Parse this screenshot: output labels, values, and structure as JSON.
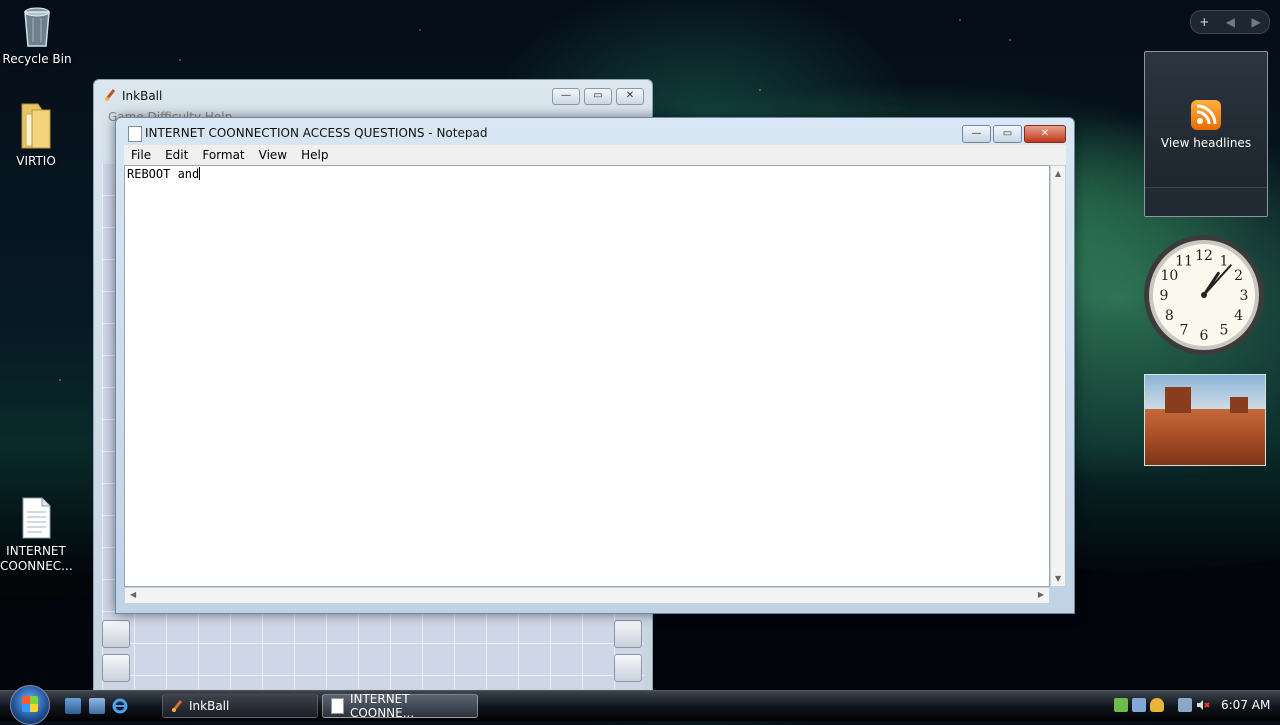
{
  "desktop": {
    "icons": [
      {
        "label": "Recycle Bin"
      },
      {
        "label": "VIRTIO"
      },
      {
        "label": "INTERNET COONNEC..."
      }
    ]
  },
  "sidebar": {
    "controls": {
      "add": "+",
      "prev": "◀",
      "next": "▶"
    },
    "feed": {
      "label": "View headlines",
      "icon": "rss-icon"
    },
    "clock": {
      "numerals": [
        "12",
        "1",
        "2",
        "3",
        "4",
        "5",
        "6",
        "7",
        "8",
        "9",
        "10",
        "11"
      ],
      "hour": 1,
      "minute": 7
    }
  },
  "inkball": {
    "title": "InkBall",
    "menu": "Game   Difficulty   Help",
    "buttons": {
      "minimize": "—",
      "maximize": "▭",
      "close": "✕"
    }
  },
  "notepad": {
    "title": "INTERNET COONNECTION ACCESS QUESTIONS - Notepad",
    "menu": [
      "File",
      "Edit",
      "Format",
      "View",
      "Help"
    ],
    "content": "REBOOT and",
    "buttons": {
      "minimize": "—",
      "maximize": "▭",
      "close": "✕"
    },
    "scroll": {
      "up": "▲",
      "down": "▼",
      "left": "◀",
      "right": "▶"
    }
  },
  "taskbar": {
    "windows": [
      {
        "label": "InkBall"
      },
      {
        "label": "INTERNET COONNE..."
      }
    ],
    "time": "6:07 AM"
  }
}
